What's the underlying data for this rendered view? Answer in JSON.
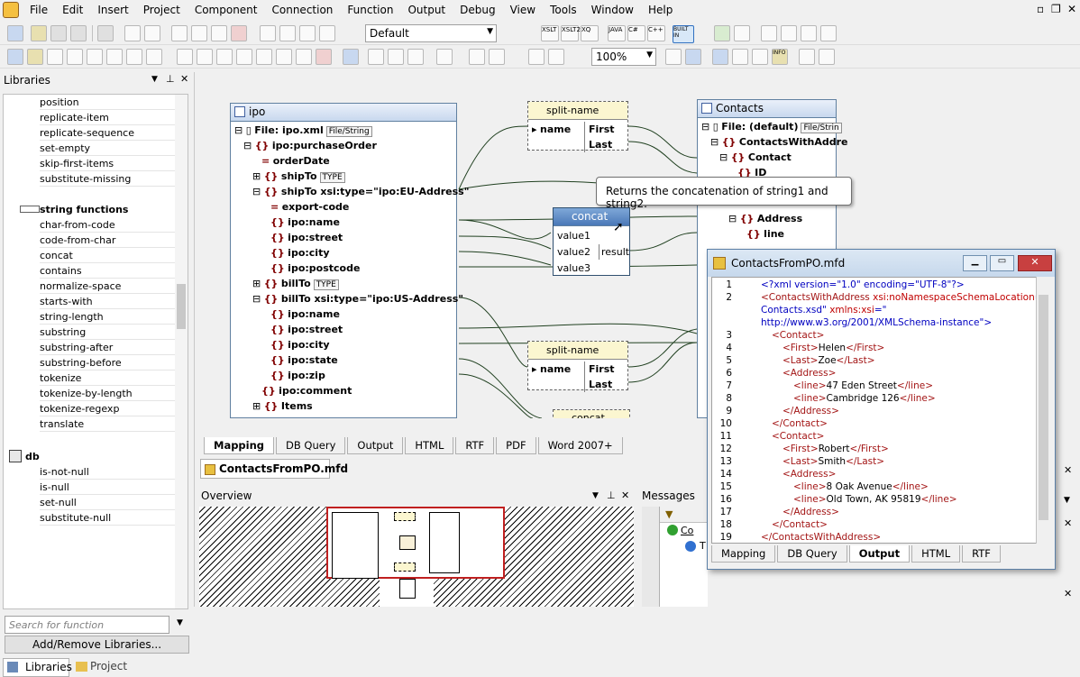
{
  "menu": [
    "File",
    "Edit",
    "Insert",
    "Project",
    "Component",
    "Connection",
    "Function",
    "Output",
    "Debug",
    "View",
    "Tools",
    "Window",
    "Help"
  ],
  "toolbar": {
    "style_combo": "Default",
    "zoom_combo": "100%",
    "lang_buttons": [
      "XSLT",
      "XSLT2",
      "XQ",
      "JAVA",
      "C#",
      "C++"
    ],
    "builtin": "BUILT IN",
    "info": "INFO"
  },
  "libraries": {
    "title": "Libraries",
    "items_top": [
      "position",
      "replicate-item",
      "replicate-sequence",
      "set-empty",
      "skip-first-items",
      "substitute-missing"
    ],
    "group_string": "string functions",
    "items_string": [
      "char-from-code",
      "code-from-char",
      "concat",
      "contains",
      "normalize-space",
      "starts-with",
      "string-length",
      "substring",
      "substring-after",
      "substring-before",
      "tokenize",
      "tokenize-by-length",
      "tokenize-regexp",
      "translate"
    ],
    "group_db": "db",
    "items_db": [
      "is-not-null",
      "is-null",
      "set-null",
      "substitute-null"
    ],
    "search_placeholder": "Search for function",
    "add_remove": "Add/Remove Libraries...",
    "tab_libraries": "Libraries",
    "tab_project": "Project"
  },
  "ipo": {
    "title": "ipo",
    "rows": [
      {
        "t": "File: ipo.xml",
        "tag": "File/String"
      },
      {
        "t": "ipo:purchaseOrder"
      },
      {
        "t": "orderDate"
      },
      {
        "t": "shipTo",
        "tag": "TYPE"
      },
      {
        "t": "shipTo xsi:type=\"ipo:EU-Address\""
      },
      {
        "t": "export-code"
      },
      {
        "t": "ipo:name"
      },
      {
        "t": "ipo:street"
      },
      {
        "t": "ipo:city"
      },
      {
        "t": "ipo:postcode"
      },
      {
        "t": "billTo",
        "tag": "TYPE"
      },
      {
        "t": "billTo xsi:type=\"ipo:US-Address\""
      },
      {
        "t": "ipo:name"
      },
      {
        "t": "ipo:street"
      },
      {
        "t": "ipo:city"
      },
      {
        "t": "ipo:state"
      },
      {
        "t": "ipo:zip"
      },
      {
        "t": "ipo:comment"
      },
      {
        "t": "Items"
      }
    ]
  },
  "split1": {
    "title": "split-name",
    "in": "name",
    "out1": "First",
    "out2": "Last"
  },
  "split2": {
    "title": "split-name",
    "in": "name",
    "out1": "First",
    "out2": "Last"
  },
  "concat": {
    "title": "concat",
    "v1": "value1",
    "v2": "value2",
    "v3": "value3",
    "result": "result"
  },
  "concat2_title": "concat",
  "contacts": {
    "title": "Contacts",
    "rows": [
      "File: (default)",
      "ContactsWithAddre",
      "Contact",
      "ID",
      "Address",
      "line"
    ],
    "tag": "File/Strin"
  },
  "tooltip": "Returns the concatenation of string1 and string2.",
  "canvas_tabs": [
    "Mapping",
    "DB Query",
    "Output",
    "HTML",
    "RTF",
    "PDF",
    "Word 2007+"
  ],
  "doc_tab": "ContactsFromPO.mfd",
  "overview_title": "Overview",
  "messages_title": "Messages",
  "messages": {
    "item1": "Co",
    "item2": "T"
  },
  "docwin": {
    "title": "ContactsFromPO.mfd",
    "tabs": [
      "Mapping",
      "DB Query",
      "Output",
      "HTML",
      "RTF"
    ],
    "lines": [
      {
        "n": "1",
        "parts": [
          {
            "c": "v",
            "s": "<?xml version=\"1.0\" encoding=\"UTF-8\"?>"
          }
        ]
      },
      {
        "n": "2",
        "parts": [
          {
            "c": "t",
            "s": "<ContactsWithAddress "
          },
          {
            "c": "a",
            "s": "xsi:noNamespaceSchemaLocation"
          },
          {
            "c": "v",
            "s": "=\""
          }
        ]
      },
      {
        "n": "",
        "parts": [
          {
            "c": "v",
            "s": "Contacts.xsd\" "
          },
          {
            "c": "a",
            "s": "xmlns:xsi"
          },
          {
            "c": "v",
            "s": "=\""
          }
        ]
      },
      {
        "n": "",
        "parts": [
          {
            "c": "v",
            "s": "http://www.w3.org/2001/XMLSchema-instance\">"
          }
        ]
      },
      {
        "n": "3",
        "parts": [
          {
            "c": "t",
            "s": "<Contact>"
          }
        ]
      },
      {
        "n": "4",
        "parts": [
          {
            "c": "t",
            "s": "<First>"
          },
          {
            "c": "tx",
            "s": "Helen"
          },
          {
            "c": "t",
            "s": "</First>"
          }
        ]
      },
      {
        "n": "5",
        "parts": [
          {
            "c": "t",
            "s": "<Last>"
          },
          {
            "c": "tx",
            "s": "Zoe"
          },
          {
            "c": "t",
            "s": "</Last>"
          }
        ]
      },
      {
        "n": "6",
        "parts": [
          {
            "c": "t",
            "s": "<Address>"
          }
        ]
      },
      {
        "n": "7",
        "parts": [
          {
            "c": "t",
            "s": "<line>"
          },
          {
            "c": "tx",
            "s": "47 Eden Street"
          },
          {
            "c": "t",
            "s": "</line>"
          }
        ]
      },
      {
        "n": "8",
        "parts": [
          {
            "c": "t",
            "s": "<line>"
          },
          {
            "c": "tx",
            "s": "Cambridge 126"
          },
          {
            "c": "t",
            "s": "</line>"
          }
        ]
      },
      {
        "n": "9",
        "parts": [
          {
            "c": "t",
            "s": "</Address>"
          }
        ]
      },
      {
        "n": "10",
        "parts": [
          {
            "c": "t",
            "s": "</Contact>"
          }
        ]
      },
      {
        "n": "11",
        "parts": [
          {
            "c": "t",
            "s": "<Contact>"
          }
        ]
      },
      {
        "n": "12",
        "parts": [
          {
            "c": "t",
            "s": "<First>"
          },
          {
            "c": "tx",
            "s": "Robert"
          },
          {
            "c": "t",
            "s": "</First>"
          }
        ]
      },
      {
        "n": "13",
        "parts": [
          {
            "c": "t",
            "s": "<Last>"
          },
          {
            "c": "tx",
            "s": "Smith"
          },
          {
            "c": "t",
            "s": "</Last>"
          }
        ]
      },
      {
        "n": "14",
        "parts": [
          {
            "c": "t",
            "s": "<Address>"
          }
        ]
      },
      {
        "n": "15",
        "parts": [
          {
            "c": "t",
            "s": "<line>"
          },
          {
            "c": "tx",
            "s": "8 Oak Avenue"
          },
          {
            "c": "t",
            "s": "</line>"
          }
        ]
      },
      {
        "n": "16",
        "parts": [
          {
            "c": "t",
            "s": "<line>"
          },
          {
            "c": "tx",
            "s": "Old Town, AK 95819"
          },
          {
            "c": "t",
            "s": "</line>"
          }
        ]
      },
      {
        "n": "17",
        "parts": [
          {
            "c": "t",
            "s": "</Address>"
          }
        ]
      },
      {
        "n": "18",
        "parts": [
          {
            "c": "t",
            "s": "</Contact>"
          }
        ]
      },
      {
        "n": "19",
        "parts": [
          {
            "c": "t",
            "s": "</ContactsWithAddress>"
          }
        ]
      }
    ]
  }
}
